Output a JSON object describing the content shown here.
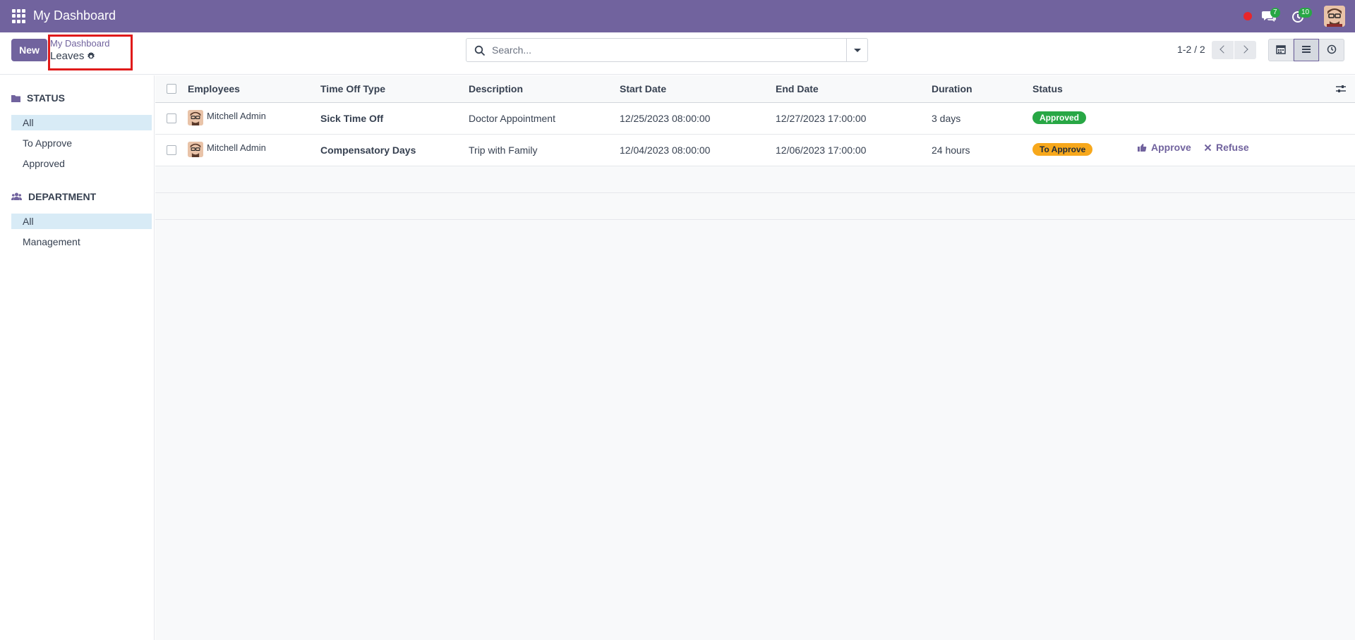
{
  "navbar": {
    "app_title": "My Dashboard",
    "chat_count": "7",
    "activity_count": "10",
    "bg_color": "#71639e",
    "icons": [
      "apps-icon",
      "record-dot-icon",
      "chat-icon",
      "activity-clock-icon",
      "user-avatar"
    ]
  },
  "control": {
    "new_label": "New",
    "breadcrumb_parent": "My Dashboard",
    "breadcrumb_current": "Leaves",
    "search_placeholder": "Search...",
    "pager": "1-2 / 2",
    "views": [
      "calendar-icon",
      "list-icon",
      "activity-icon"
    ],
    "active_view": "list"
  },
  "sidebar": {
    "status_title": "STATUS",
    "status_items": [
      "All",
      "To Approve",
      "Approved"
    ],
    "status_active": "All",
    "department_title": "DEPARTMENT",
    "department_items": [
      "All",
      "Management"
    ],
    "department_active": "All"
  },
  "table": {
    "headers": [
      "Employees",
      "Time Off Type",
      "Description",
      "Start Date",
      "End Date",
      "Duration",
      "Status"
    ],
    "rows": [
      {
        "employee": "Mitchell Admin",
        "type": "Sick Time Off",
        "description": "Doctor Appointment",
        "start": "12/25/2023 08:00:00",
        "end": "12/27/2023 17:00:00",
        "duration": "3 days",
        "status": "Approved"
      },
      {
        "employee": "Mitchell Admin",
        "type": "Compensatory Days",
        "description": "Trip with Family",
        "start": "12/04/2023 08:00:00",
        "end": "12/06/2023 17:00:00",
        "duration": "24 hours",
        "status": "To Approve",
        "approve_label": "Approve",
        "refuse_label": "Refuse"
      }
    ],
    "status_colors": {
      "Approved": "#28a745",
      "To Approve": "#f7a81c"
    }
  }
}
